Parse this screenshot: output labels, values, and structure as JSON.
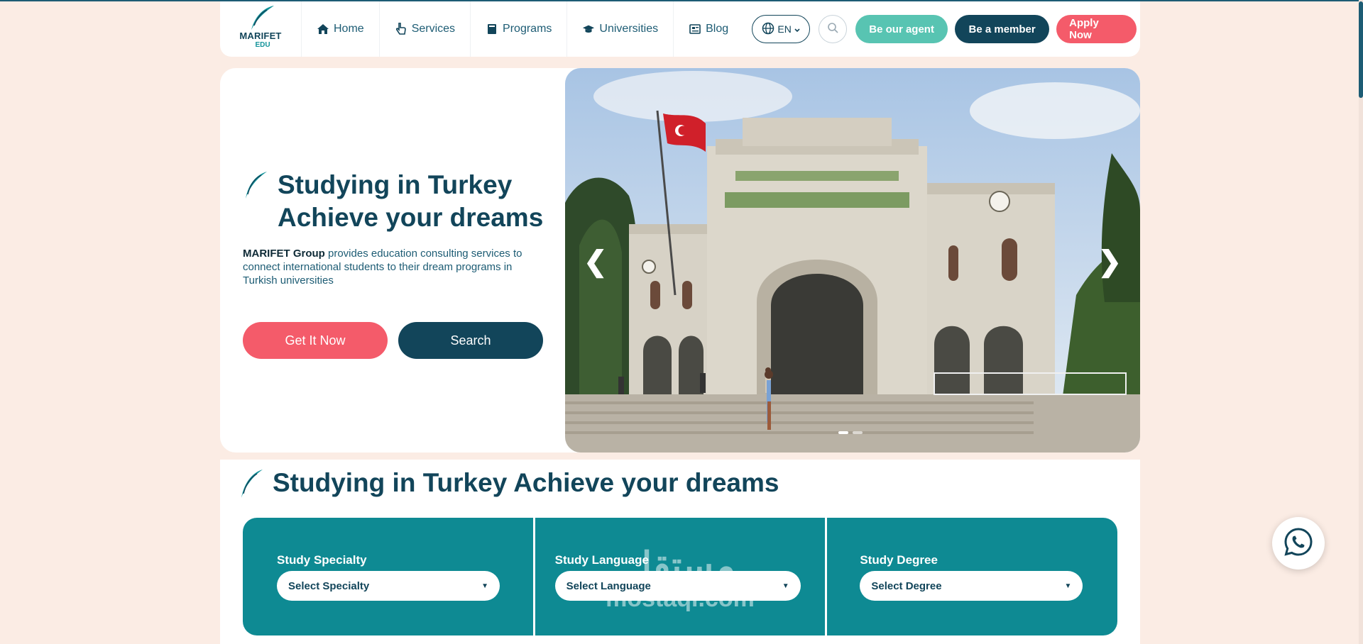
{
  "brand": {
    "name": "MARIFET",
    "sub": "EDU"
  },
  "nav": {
    "items": [
      {
        "label": "Home",
        "icon": "home-icon"
      },
      {
        "label": "Services",
        "icon": "hand-pointer-icon"
      },
      {
        "label": "Programs",
        "icon": "book-icon"
      },
      {
        "label": "Universities",
        "icon": "graduation-cap-icon"
      },
      {
        "label": "Blog",
        "icon": "newspaper-icon"
      }
    ],
    "language": "EN",
    "agent_label": "Be our agent",
    "member_label": "Be a member",
    "apply_label": "Apply Now"
  },
  "hero": {
    "title_line1": "Studying in Turkey",
    "title_line2": "Achieve your dreams",
    "desc_bold": "MARIFET Group",
    "desc_rest": " provides education consulting services to connect international students to their dream programs in Turkish universities",
    "get_label": "Get It Now",
    "search_label": "Search",
    "prev_arrow": "❮",
    "next_arrow": "❯",
    "slide_count": 2,
    "active_slide": 1
  },
  "section": {
    "title": "Studying in Turkey Achieve your dreams",
    "filters": [
      {
        "label": "Study Specialty",
        "placeholder": "Select Specialty"
      },
      {
        "label": "Study Language",
        "placeholder": "Select Language"
      },
      {
        "label": "Study Degree",
        "placeholder": "Select Degree"
      }
    ]
  },
  "watermark": {
    "line1": "مستقل",
    "line2": "mostaql.com"
  },
  "colors": {
    "primary": "#12455a",
    "teal": "#0e8a93",
    "coral": "#f45b6a",
    "mint": "#58c4b2",
    "page_bg": "#fbece4"
  }
}
